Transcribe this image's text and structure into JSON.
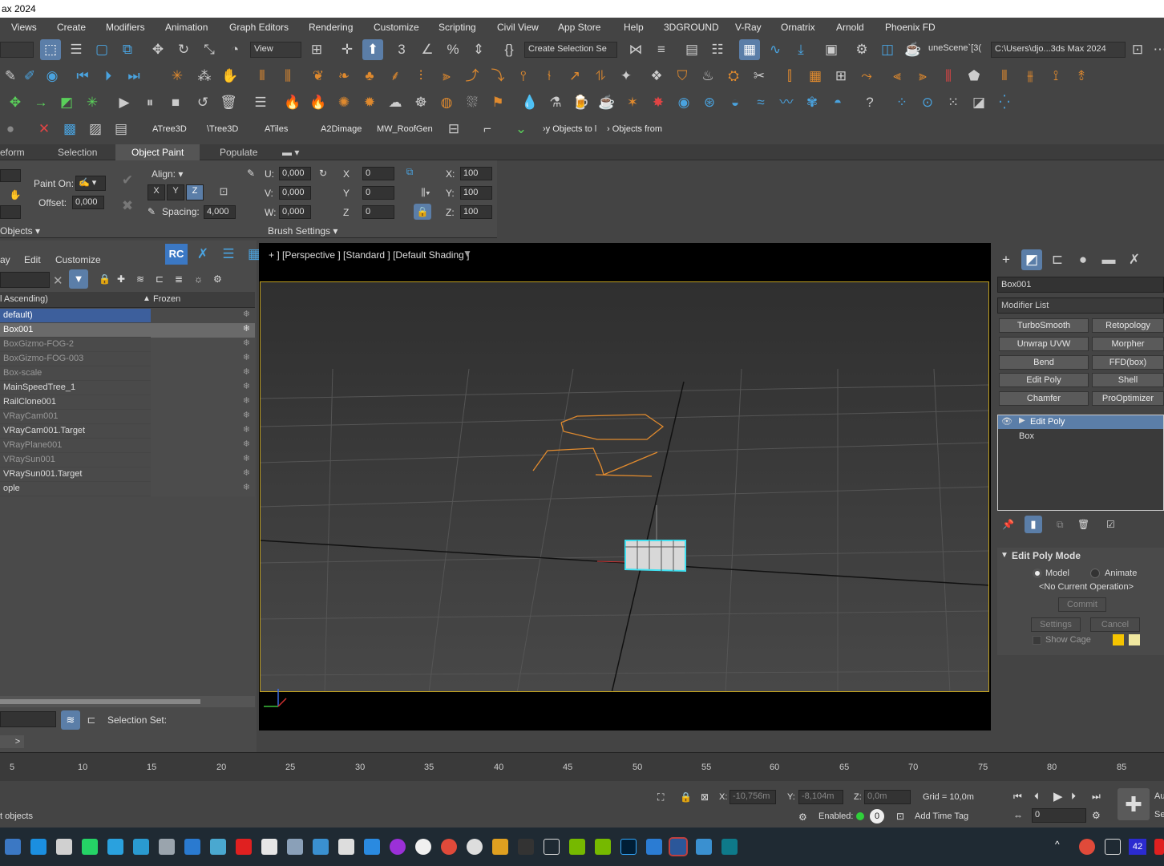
{
  "window": {
    "title": "ax 2024"
  },
  "menu": [
    "Views",
    "Create",
    "Modifiers",
    "Animation",
    "Graph Editors",
    "Rendering",
    "Customize",
    "Scripting",
    "Civil View",
    "App Store",
    "Help",
    "3DGROUND",
    "V-Ray",
    "Ornatrix",
    "Arnold",
    "Phoenix FD"
  ],
  "toolbar": {
    "view_dropdown": "View",
    "selection_set": "Create Selection Se",
    "scene_name": "uneScene`[3(",
    "project_path": "C:\\Users\\djo...3ds Max 2024"
  },
  "plugin_buttons": [
    "ATree3D",
    "\\Tree3D",
    "ATiles",
    "A2Dimage",
    "MW_RoofGen",
    "›y Objects to l",
    "› Objects from"
  ],
  "ribbon": {
    "tabs": [
      "eform",
      "Selection",
      "Object Paint",
      "Populate"
    ],
    "active_tab": "Object Paint",
    "paint_on_label": "Paint On:",
    "offset_label": "Offset:",
    "offset_value": "0,000",
    "align_label": "Align:",
    "spacing_label": "Spacing:",
    "spacing_value": "4,000",
    "axes": [
      "X",
      "Y",
      "Z"
    ],
    "u_label": "U:",
    "u_value": "0,000",
    "v_label": "V:",
    "v_value": "0,000",
    "w_label": "W:",
    "w_value": "0,000",
    "rx_label": "X",
    "rx_value": "0",
    "ry_label": "Y",
    "ry_value": "0",
    "rz_label": "Z",
    "rz_value": "0",
    "sx_label": "X:",
    "sx_value": "100",
    "sy_label": "Y:",
    "sy_value": "100",
    "sz_label": "Z:",
    "sz_value": "100",
    "objects_panel": "Objects",
    "brush_panel": "Brush Settings"
  },
  "explorer": {
    "menu": [
      "ay",
      "Edit",
      "Customize"
    ],
    "rc_label": "RC",
    "col_name": "l Ascending)",
    "col_frozen": "Frozen",
    "rows": [
      {
        "name": "default)",
        "state": "layer"
      },
      {
        "name": "Box001",
        "state": "selected"
      },
      {
        "name": "BoxGizmo-FOG-2",
        "state": "dim"
      },
      {
        "name": "BoxGizmo-FOG-003",
        "state": "dim"
      },
      {
        "name": "Box-scale",
        "state": "dim"
      },
      {
        "name": "MainSpeedTree_1",
        "state": "normal"
      },
      {
        "name": "RailClone001",
        "state": "normal"
      },
      {
        "name": "VRayCam001",
        "state": "dim"
      },
      {
        "name": "VRayCam001.Target",
        "state": "normal"
      },
      {
        "name": "VRayPlane001",
        "state": "dim"
      },
      {
        "name": "VRaySun001",
        "state": "dim"
      },
      {
        "name": "VRaySun001.Target",
        "state": "normal"
      },
      {
        "name": "ople",
        "state": "normal"
      }
    ],
    "selection_set_label": "Selection Set:"
  },
  "viewport": {
    "label": "+ ] [Perspective ] [Standard ] [Default Shading ]"
  },
  "command_panel": {
    "object_name": "Box001",
    "modifier_list": "Modifier List",
    "buttons": [
      "TurboSmooth",
      "Retopology",
      "Unwrap UVW",
      "Morpher",
      "Bend",
      "FFD(box)",
      "Edit Poly",
      "Shell",
      "Chamfer",
      "ProOptimizer"
    ],
    "stack": [
      "Edit Poly",
      "Box"
    ],
    "rollout_title": "Edit Poly Mode",
    "mode_model": "Model",
    "mode_animate": "Animate",
    "current_operation": "<No Current Operation>",
    "commit": "Commit",
    "settings": "Settings",
    "cancel": "Cancel",
    "show_cage": "Show Cage"
  },
  "timeline": {
    "ticks": [
      "5",
      "10",
      "15",
      "20",
      "25",
      "30",
      "35",
      "40",
      "45",
      "50",
      "55",
      "60",
      "65",
      "70",
      "75",
      "80",
      "85"
    ]
  },
  "status": {
    "objects_text": "t objects",
    "x_label": "X:",
    "x_value": "-10,756m",
    "y_label": "Y:",
    "y_value": "-8,104m",
    "z_label": "Z:",
    "z_value": "0,0m",
    "grid": "Grid = 10,0m",
    "enabled_label": "Enabled:",
    "enabled_value": "0",
    "add_time_tag": "Add Time Tag",
    "frame_value": "0",
    "auto_label": "Au",
    "set_label": "Se"
  },
  "tray": {
    "badge": "42"
  },
  "colors": {
    "accent": "#5b7ea8",
    "viewport_border": "#c0a020",
    "selection_cyan": "#40e0f0",
    "spline_orange": "#e08a2e"
  }
}
